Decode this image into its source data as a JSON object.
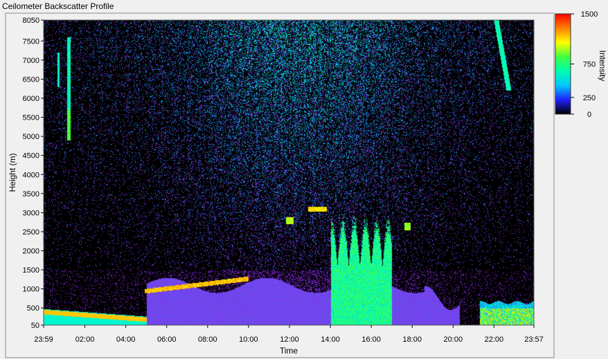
{
  "chart_data": {
    "type": "heatmap",
    "title": "Ceilometer Backscatter Profile",
    "xlabel": "Time",
    "ylabel": "Height (m)",
    "x_ticks": [
      "23:59",
      "02:00",
      "04:00",
      "06:00",
      "08:00",
      "10:00",
      "12:00",
      "14:00",
      "16:00",
      "18:00",
      "20:00",
      "22:00",
      "23:57"
    ],
    "x_range_hours": [
      -0.0167,
      23.95
    ],
    "y_ticks": [
      50,
      500,
      1000,
      1500,
      2000,
      2500,
      3000,
      3500,
      4000,
      4500,
      5000,
      5500,
      6000,
      6500,
      7000,
      7500,
      8050
    ],
    "ylim": [
      50,
      8050
    ],
    "colorbar": {
      "label": "Intensity",
      "ticks": [
        0,
        250,
        750,
        1500
      ],
      "range": [
        0,
        1500
      ],
      "colors": [
        "#000000",
        "#2020ff",
        "#00c8ff",
        "#00ffb0",
        "#40ff40",
        "#ffff00",
        "#ff8000",
        "#ff0000"
      ]
    },
    "colors": {
      "background": "#000000",
      "low": "#8a2be2",
      "mid": "#00e5ff",
      "high": "#ffff00",
      "peak": "#ff2a00"
    },
    "features": [
      {
        "name": "boundary layer",
        "time_start_h": 5.0,
        "time_end_h": 20.3,
        "height_top_m": 1100,
        "intensity": 80
      },
      {
        "name": "morning surface layer",
        "time_start_h": 0.0,
        "time_end_h": 5.0,
        "height_top_m": 450,
        "intensity": 300
      },
      {
        "name": "afternoon convection",
        "time_start_h": 14.0,
        "time_end_h": 17.0,
        "height_top_m": 3200,
        "intensity": 300
      },
      {
        "name": "cloud 1",
        "time_h": 1.2,
        "height_base_m": 4900,
        "height_top_m": 7600,
        "intensity": 350
      },
      {
        "name": "cloud 2",
        "time_h": 22.8,
        "height_base_m": 6200,
        "height_top_m": 8050,
        "intensity": 300
      },
      {
        "name": "cloud 3",
        "time_h": 13.3,
        "height_base_m": 3050,
        "height_top_m": 3150,
        "intensity": 600
      },
      {
        "name": "evening surface layer",
        "time_start_h": 21.3,
        "time_end_h": 23.95,
        "height_top_m": 600,
        "intensity": 300
      }
    ]
  }
}
